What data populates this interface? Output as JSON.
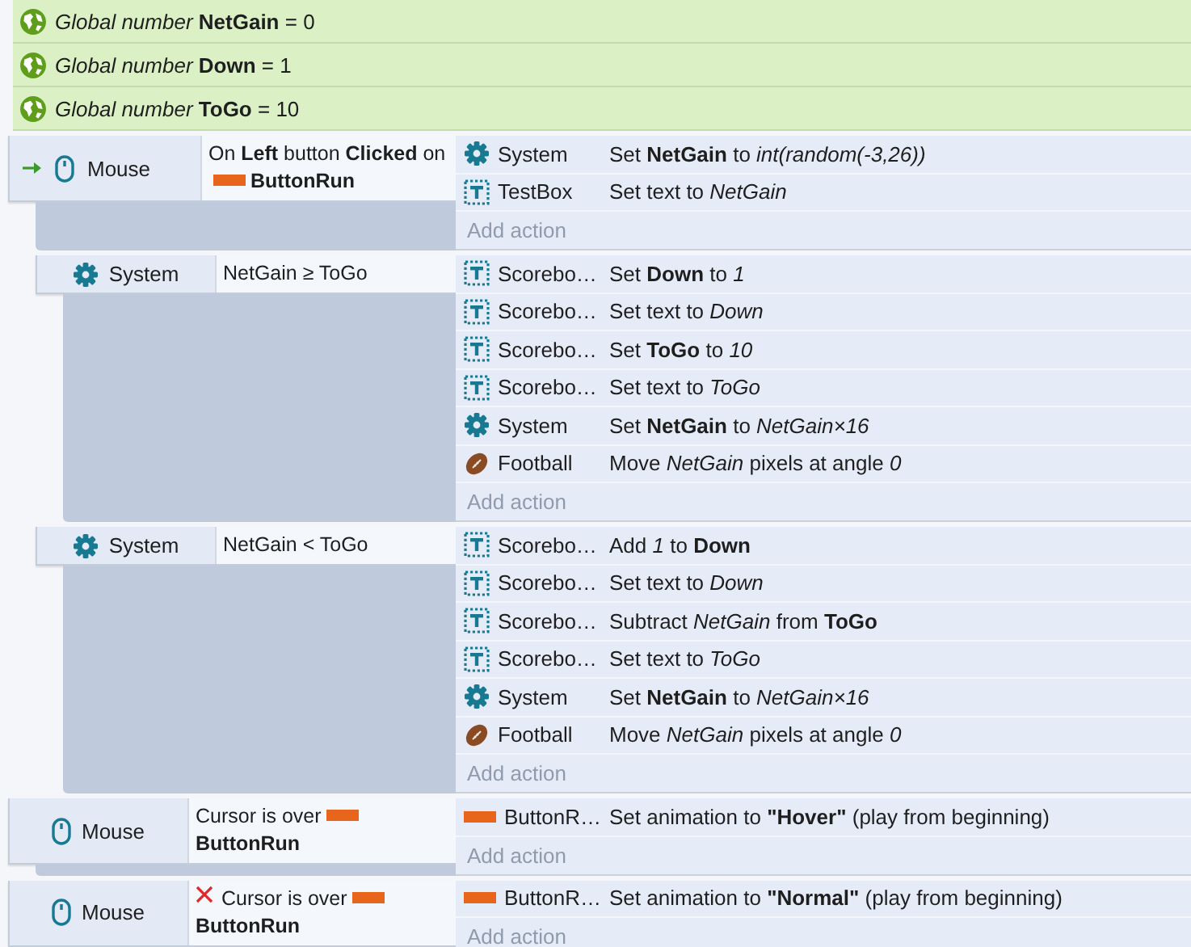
{
  "globals": [
    {
      "text": "*Global number* **NetGain** = 0"
    },
    {
      "text": "*Global number* **Down** = 1"
    },
    {
      "text": "*Global number* **ToGo** = 10"
    }
  ],
  "events": [
    {
      "trigger": true,
      "conditions": [
        {
          "object": "Mouse",
          "kind": "mouse",
          "inverted": false,
          "text": "On **Left** button **Clicked** on",
          "target": {
            "name": "ButtonRun",
            "kind": "sprite"
          }
        }
      ],
      "actions": [
        {
          "object": "System",
          "kind": "system",
          "text": "Set **NetGain** to *int(random(-3,26))*"
        },
        {
          "object": "TestBox",
          "kind": "text",
          "text": "Set text to *NetGain*"
        }
      ],
      "add_action": "Add action",
      "children": [
        {
          "trigger": false,
          "conditions": [
            {
              "object": "System",
              "kind": "system",
              "inverted": false,
              "text": "NetGain ≥ ToGo"
            }
          ],
          "actions": [
            {
              "object": "Scorebo…",
              "kind": "text",
              "text": "Set **Down** to *1*"
            },
            {
              "object": "Scorebo…",
              "kind": "text",
              "text": "Set text to *Down*"
            },
            {
              "object": "Scorebo…",
              "kind": "text",
              "text": "Set **ToGo** to *10*"
            },
            {
              "object": "Scorebo…",
              "kind": "text",
              "text": "Set text to *ToGo*"
            },
            {
              "object": "System",
              "kind": "system",
              "text": "Set **NetGain** to *NetGain×16*"
            },
            {
              "object": "Football",
              "kind": "football",
              "text": "Move *NetGain* pixels at angle *0*"
            }
          ],
          "add_action": "Add action"
        },
        {
          "trigger": false,
          "conditions": [
            {
              "object": "System",
              "kind": "system",
              "inverted": false,
              "text": "NetGain < ToGo"
            }
          ],
          "actions": [
            {
              "object": "Scorebo…",
              "kind": "text",
              "text": "Add *1* to **Down**"
            },
            {
              "object": "Scorebo…",
              "kind": "text",
              "text": "Set text to *Down*"
            },
            {
              "object": "Scorebo…",
              "kind": "text",
              "text": "Subtract *NetGain* from **ToGo**"
            },
            {
              "object": "Scorebo…",
              "kind": "text",
              "text": "Set text to *ToGo*"
            },
            {
              "object": "System",
              "kind": "system",
              "text": "Set **NetGain** to *NetGain×16*"
            },
            {
              "object": "Football",
              "kind": "football",
              "text": "Move *NetGain* pixels at angle *0*"
            }
          ],
          "add_action": "Add action"
        }
      ]
    },
    {
      "trigger": false,
      "conditions": [
        {
          "object": "Mouse",
          "kind": "mouse",
          "inverted": false,
          "text": "Cursor is over",
          "target": {
            "name": "ButtonRun",
            "kind": "sprite"
          }
        }
      ],
      "actions": [
        {
          "object": "ButtonR…",
          "kind": "sprite",
          "text": "Set animation to **\"Hover\"** (play from beginning)"
        }
      ],
      "add_action": "Add action"
    },
    {
      "trigger": false,
      "conditions": [
        {
          "object": "Mouse",
          "kind": "mouse",
          "inverted": true,
          "text": "Cursor is over",
          "target": {
            "name": "ButtonRun",
            "kind": "sprite"
          }
        }
      ],
      "actions": [
        {
          "object": "ButtonR…",
          "kind": "sprite",
          "text": "Set animation to **\"Normal\"** (play from beginning)"
        }
      ],
      "add_action": "Add action"
    }
  ]
}
